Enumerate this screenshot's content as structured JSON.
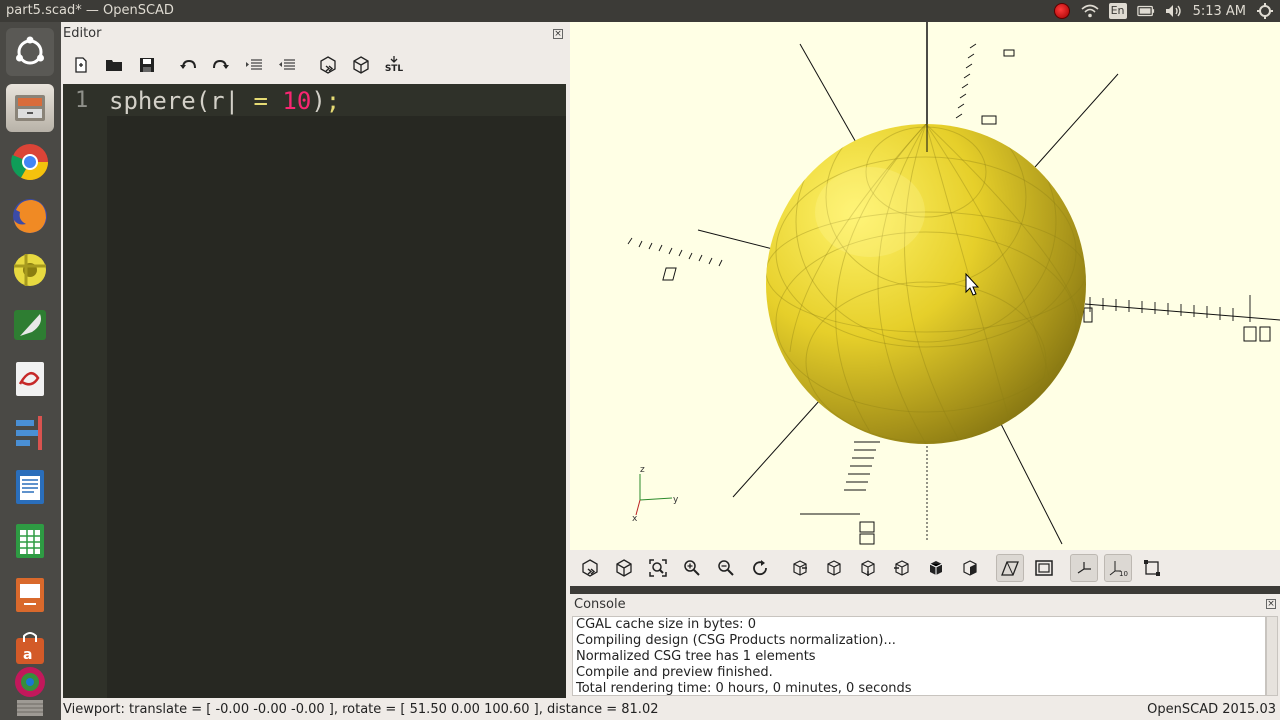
{
  "window": {
    "title": "part5.scad* — OpenSCAD"
  },
  "tray": {
    "language": "En",
    "time": "5:13 AM"
  },
  "launcher": {
    "items": [
      {
        "name": "ubuntu-dash",
        "icon": "ubuntu-logo-icon"
      },
      {
        "name": "files",
        "icon": "file-cabinet-icon"
      },
      {
        "name": "chrome",
        "icon": "chrome-icon"
      },
      {
        "name": "firefox",
        "icon": "firefox-icon"
      },
      {
        "name": "openscad",
        "icon": "openscad-icon"
      },
      {
        "name": "inkscape",
        "icon": "feather-icon"
      },
      {
        "name": "document-viewer",
        "icon": "pdf-icon"
      },
      {
        "name": "git-tool",
        "icon": "branch-icon"
      },
      {
        "name": "writer",
        "icon": "document-icon"
      },
      {
        "name": "calc",
        "icon": "spreadsheet-icon"
      },
      {
        "name": "impress",
        "icon": "presentation-icon"
      },
      {
        "name": "software-center",
        "icon": "shopping-bag-icon"
      },
      {
        "name": "image-viewer",
        "icon": "photo-icon"
      },
      {
        "name": "trash",
        "icon": "trash-icon"
      }
    ]
  },
  "editor": {
    "title": "Editor",
    "toolbar": [
      "new",
      "open",
      "save",
      "undo",
      "redo",
      "indent",
      "unindent",
      "preview",
      "render",
      "export-stl"
    ],
    "stl_label": "STL",
    "line_number": "1",
    "code": {
      "ident": "sphere",
      "lparen": "(",
      "param": "r",
      "eq": "=",
      "value": "10",
      "rparen": ")",
      "semi": ";"
    }
  },
  "viewport": {
    "object": "sphere",
    "object_color": "#f3e23c",
    "background": "#ffffe5",
    "axis_labels": {
      "x": "x",
      "y": "y",
      "z": "z"
    }
  },
  "view_toolbar": [
    "preview",
    "render",
    "view-all",
    "zoom-in",
    "zoom-out",
    "reset-view",
    "view-right",
    "view-top",
    "view-bottom",
    "view-left",
    "view-front",
    "view-back",
    "perspective",
    "orthogonal",
    "show-axes",
    "show-scale-markers",
    "show-edges"
  ],
  "console": {
    "title": "Console",
    "lines": [
      "CGAL cache size in bytes: 0",
      "Compiling design (CSG Products normalization)...",
      "Normalized CSG tree has 1 elements",
      "Compile and preview finished.",
      "Total rendering time: 0 hours, 0 minutes, 0 seconds"
    ]
  },
  "status": {
    "viewport": "Viewport: translate = [ -0.00 -0.00 -0.00 ], rotate = [ 51.50 0.00 100.60 ], distance = 81.02",
    "version": "OpenSCAD 2015.03"
  }
}
